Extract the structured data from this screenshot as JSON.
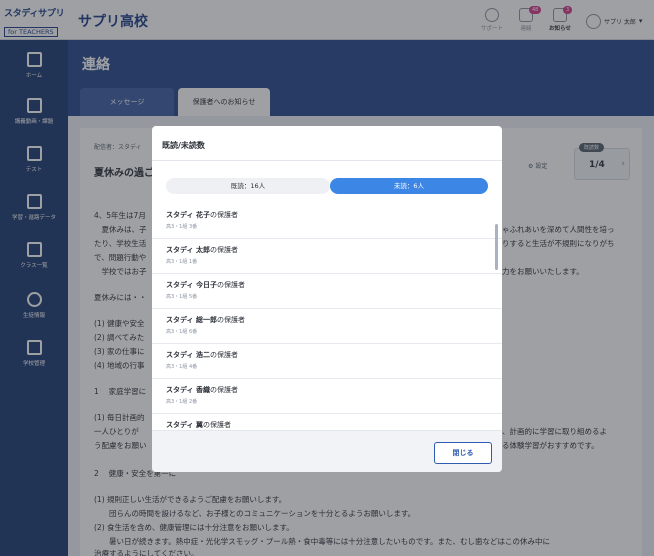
{
  "app": {
    "logo_main": "スタディサプリ",
    "logo_sub": "for TEACHERS",
    "school_name": "サプリ高校"
  },
  "header": {
    "support_label": "サポート",
    "contact_label": "連絡",
    "contact_badge": "48",
    "notice_label": "お知らせ",
    "notice_badge": "3",
    "user_name": "サプリ 太郎",
    "user_chevron": "▾"
  },
  "sidebar": {
    "items": [
      {
        "label": "ホーム",
        "icon": "home-icon"
      },
      {
        "label": "講義動画・課題",
        "icon": "video-icon"
      },
      {
        "label": "テスト",
        "icon": "test-icon"
      },
      {
        "label": "学習・進路データ",
        "icon": "chart-icon"
      },
      {
        "label": "クラス一覧",
        "icon": "class-icon"
      },
      {
        "label": "生徒情報",
        "icon": "students-icon"
      },
      {
        "label": "学校管理",
        "icon": "building-icon"
      }
    ]
  },
  "main": {
    "title": "連絡",
    "tabs": [
      {
        "label": "メッセージ",
        "active": false
      },
      {
        "label": "保護者へのお知らせ",
        "active": true
      }
    ]
  },
  "message": {
    "sender_label": "配信者：スタディ",
    "title": "夏休みの過ご",
    "settings_label": "設定",
    "read_count_label": "既読数",
    "read_count_value": "1/4",
    "lines": [
      "4、5年生は7月",
      "　夏休みは、子",
      "たり、学校生活",
      "で、問題行動や",
      "　学校ではお子",
      "夏休みには・・",
      "(1) 健康や安全",
      "(2) 調べてみた",
      "(3) 家の仕事に",
      "(4) 地域の行事",
      "1　 家庭学習に",
      "(1) 毎日計画的",
      "一人ひとりが",
      "う配慮をお願い",
      "2　 健康・安全を第一に",
      "(1) 規則正しい生活ができるようご配慮をお願いします。",
      "　　団らんの時間を設けるなど、お子様とのコミュニケーションを十分とるようお願いします。",
      "(2) 食生活を含め、健康管理には十分注意をお願いします。",
      "　　暑い日が続きます。熱中症・光化学スモッグ・プール熱・食中毒等には十分注意したいものです。また、むし歯などはこの休み中に",
      "治療するようにしてください。"
    ],
    "right_lines": [
      "ゃふれあいを深めて人間性を培っ",
      "りすると生活が不規則になりがち",
      "力をお願いいたします。",
      "、計画的に学習に取り組めるよ",
      "る体験学習がおすすめです。"
    ]
  },
  "modal": {
    "title": "既読/未読数",
    "tab_read": "既読：16人",
    "tab_unread": "未読：6人",
    "items": [
      {
        "name": "スタディ 花子",
        "suffix": "の保護者",
        "class": "高3・1組 3番"
      },
      {
        "name": "スタディ 太郎",
        "suffix": "の保護者",
        "class": "高3・1組 1番"
      },
      {
        "name": "スタディ 今日子",
        "suffix": "の保護者",
        "class": "高3・1組 5番"
      },
      {
        "name": "スタディ 総一郎",
        "suffix": "の保護者",
        "class": "高3・1組 6番"
      },
      {
        "name": "スタディ 浩二",
        "suffix": "の保護者",
        "class": "高3・1組 4番"
      },
      {
        "name": "スタディ 香織",
        "suffix": "の保護者",
        "class": "高3・1組 2番"
      },
      {
        "name": "スタディ 翼",
        "suffix": "の保護者",
        "class": ""
      }
    ],
    "close_label": "閉じる"
  }
}
